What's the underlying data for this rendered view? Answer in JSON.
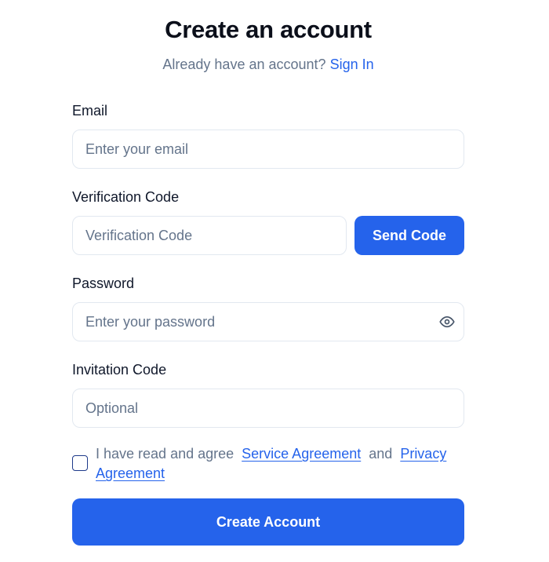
{
  "header": {
    "title": "Create an account",
    "subtitle_prefix": "Already have an account?",
    "sign_in_link": "Sign In"
  },
  "form": {
    "email": {
      "label": "Email",
      "placeholder": "Enter your email",
      "value": ""
    },
    "verification": {
      "label": "Verification Code",
      "placeholder": "Verification Code",
      "value": "",
      "send_button": "Send Code"
    },
    "password": {
      "label": "Password",
      "placeholder": "Enter your password",
      "value": "",
      "toggle_icon": "eye-icon"
    },
    "invitation": {
      "label": "Invitation Code",
      "placeholder": "Optional",
      "value": ""
    },
    "agreement": {
      "checked": false,
      "prefix": "I have read and agree",
      "service_link": "Service Agreement",
      "conjunction": "and",
      "privacy_link": "Privacy Agreement"
    },
    "submit_label": "Create Account"
  },
  "colors": {
    "accent": "#2563eb",
    "muted_text": "#64748b",
    "border": "#e2e8f0"
  }
}
